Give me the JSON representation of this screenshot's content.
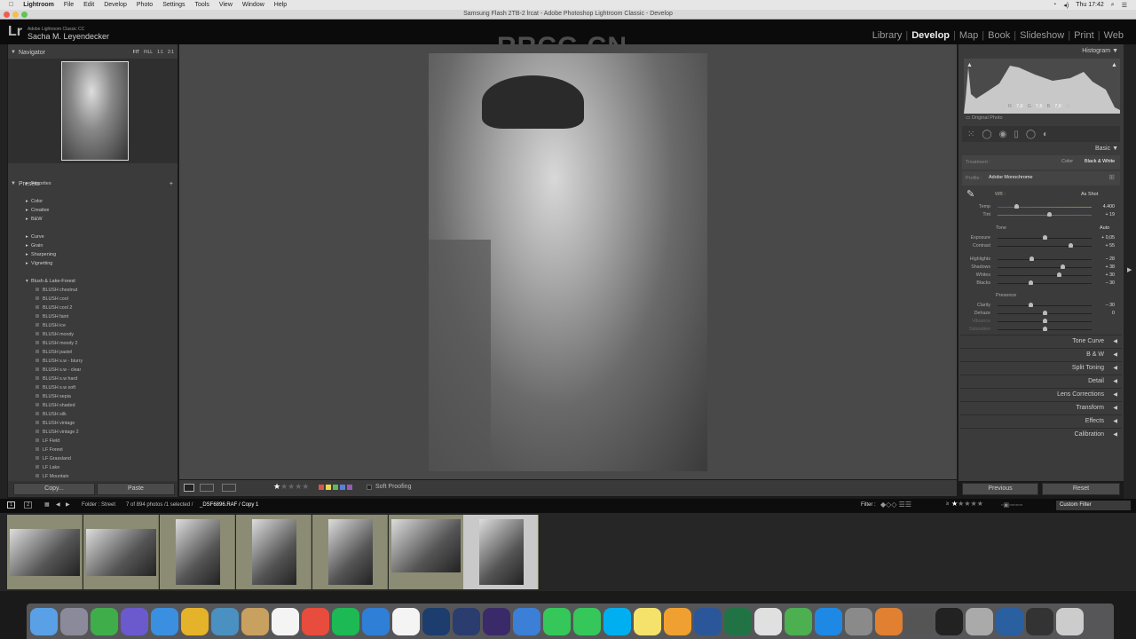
{
  "menubar": {
    "apple": "",
    "app": "Lightroom",
    "items": [
      "File",
      "Edit",
      "Develop",
      "Photo",
      "Settings",
      "Tools",
      "View",
      "Window",
      "Help"
    ],
    "clock": "Thu 17:42"
  },
  "window": {
    "title": "Samsung Flash 2TB-2 lrcat - Adobe Photoshop Lightroom Classic - Develop"
  },
  "header": {
    "logo": "Lr",
    "catalog": "Adobe Lightroom Classic CC",
    "user": "Sacha M. Leyendecker",
    "watermark": "RRCG.CN",
    "modules": [
      "Library",
      "Develop",
      "Map",
      "Book",
      "Slideshow",
      "Print",
      "Web"
    ],
    "active_module": "Develop"
  },
  "navigator": {
    "title": "Navigator",
    "zoom_options": [
      "FIT",
      "FILL",
      "1:1",
      "2:1"
    ]
  },
  "presets": {
    "title": "Presets",
    "add": "+",
    "groups_top": [
      "Favorites"
    ],
    "groups_a": [
      "Color",
      "Creative",
      "B&W"
    ],
    "groups_b": [
      "Curve",
      "Grain",
      "Sharpening",
      "Vignetting"
    ],
    "open_group": "Blush & Lake-Forest",
    "items": [
      "BLUSH chestnut",
      "BLUSH cool",
      "BLUSH cool 2",
      "BLUSH faint",
      "BLUSH ice",
      "BLUSH moody",
      "BLUSH moody 2",
      "BLUSH pastel",
      "BLUSH s.w - blurry",
      "BLUSH s.w - clear",
      "BLUSH s.w hard",
      "BLUSH s.w soft",
      "BLUSH sepia",
      "BLUSH shaded",
      "BLUSH silk",
      "BLUSH vintage",
      "BLUSH vintage 2",
      "LF Field",
      "LF Forest",
      "LF Grassland",
      "LF Lake",
      "LF Mountain"
    ]
  },
  "left_buttons": {
    "copy": "Copy...",
    "paste": "Paste"
  },
  "toolbar": {
    "soft_proofing": "Soft Proofing",
    "rating": 1,
    "color_labels": [
      "#d9534f",
      "#e8d84a",
      "#5cb85c",
      "#5b7fd6",
      "#9b59b6"
    ]
  },
  "histogram": {
    "title": "Histogram",
    "r_label": "R",
    "r": "7,6",
    "g_label": "G",
    "g": "7,6",
    "b_label": "B",
    "b": "7,6",
    "pct": "%",
    "original_photo": "Original Photo"
  },
  "basic": {
    "title": "Basic",
    "treatment_label": "Treatment :",
    "treatment_color": "Color",
    "treatment_bw": "Black & White",
    "profile_label": "Profile :",
    "profile": "Adobe Monochrome",
    "wb_label": "WB :",
    "wb": "As Shot",
    "tone_label": "Tone",
    "auto": "Auto",
    "presence_label": "Presence",
    "sliders": [
      {
        "label": "Temp",
        "value": "4.400",
        "level": 0.2
      },
      {
        "label": "Tint",
        "value": "+ 19",
        "level": 0.55
      },
      {
        "label": "Exposure",
        "value": "+ 0,05",
        "level": 0.5
      },
      {
        "label": "Contrast",
        "value": "+ 55",
        "level": 0.77
      },
      {
        "label": "Highlights",
        "value": "– 28",
        "level": 0.36
      },
      {
        "label": "Shadows",
        "value": "+ 38",
        "level": 0.69
      },
      {
        "label": "Whites",
        "value": "+ 30",
        "level": 0.65
      },
      {
        "label": "Blacks",
        "value": "– 30",
        "level": 0.35
      },
      {
        "label": "Clarity",
        "value": "– 30",
        "level": 0.35
      },
      {
        "label": "Dehaze",
        "value": "0",
        "level": 0.5
      },
      {
        "label": "Vibrance",
        "value": "",
        "level": 0.5
      },
      {
        "label": "Saturation",
        "value": "",
        "level": 0.5
      }
    ]
  },
  "sections": [
    "Tone Curve",
    "B & W",
    "Split Toning",
    "Detail",
    "Lens Corrections",
    "Transform",
    "Effects",
    "Calibration"
  ],
  "right_buttons": {
    "previous": "Previous",
    "reset": "Reset"
  },
  "filmstrip_bar": {
    "view1": "1",
    "view2": "2",
    "folder": "Folder : Street",
    "count": "7 of 894 photos /1 selected /",
    "file": "_DSF6896.RAF / Copy 1",
    "filter_label": "Filter :",
    "rating_op": "≥",
    "filter_preset": "Custom Filter"
  },
  "filmstrip": {
    "count": 7,
    "selected_index": 6
  },
  "dock": {
    "apps": [
      "Finder",
      "Launchpad",
      "Evernote",
      "Siri",
      "Safari",
      "Chrome",
      "Preview",
      "Notes",
      "Calendar",
      "Grammarly",
      "Spotify",
      "Keynote",
      "Reminders",
      "Photoshop",
      "Lightroom",
      "Rush",
      "1Password",
      "Messages",
      "FaceTime",
      "Skype",
      "Stickies",
      "Pages",
      "Word",
      "Excel",
      "TextEdit",
      "Numbers",
      "App Store",
      "System Preferences",
      "Books",
      "Printer",
      "Terminal",
      "Scripts",
      "QuickTime",
      "Display",
      "Trash"
    ],
    "colors": [
      "#5aa0e6",
      "#8a8a9a",
      "#3fae4a",
      "#6a5acd",
      "#3b8fe0",
      "#e5b32a",
      "#4a90c0",
      "#c8a060",
      "#f4f4f4",
      "#e74c3c",
      "#1db954",
      "#2f7fd6",
      "#f4f4f4",
      "#1c3d6e",
      "#2a3d6e",
      "#3b2a6a",
      "#3b7fd6",
      "#35c759",
      "#35c759",
      "#00aff0",
      "#f5e26b",
      "#f0a030",
      "#2b579a",
      "#217346",
      "#e0e0e0",
      "#4caf50",
      "#1e88e5",
      "#8a8a8a",
      "#e08030",
      "#555",
      "#222",
      "#aaa",
      "#2a5fa0",
      "#333",
      "#ccc"
    ]
  }
}
